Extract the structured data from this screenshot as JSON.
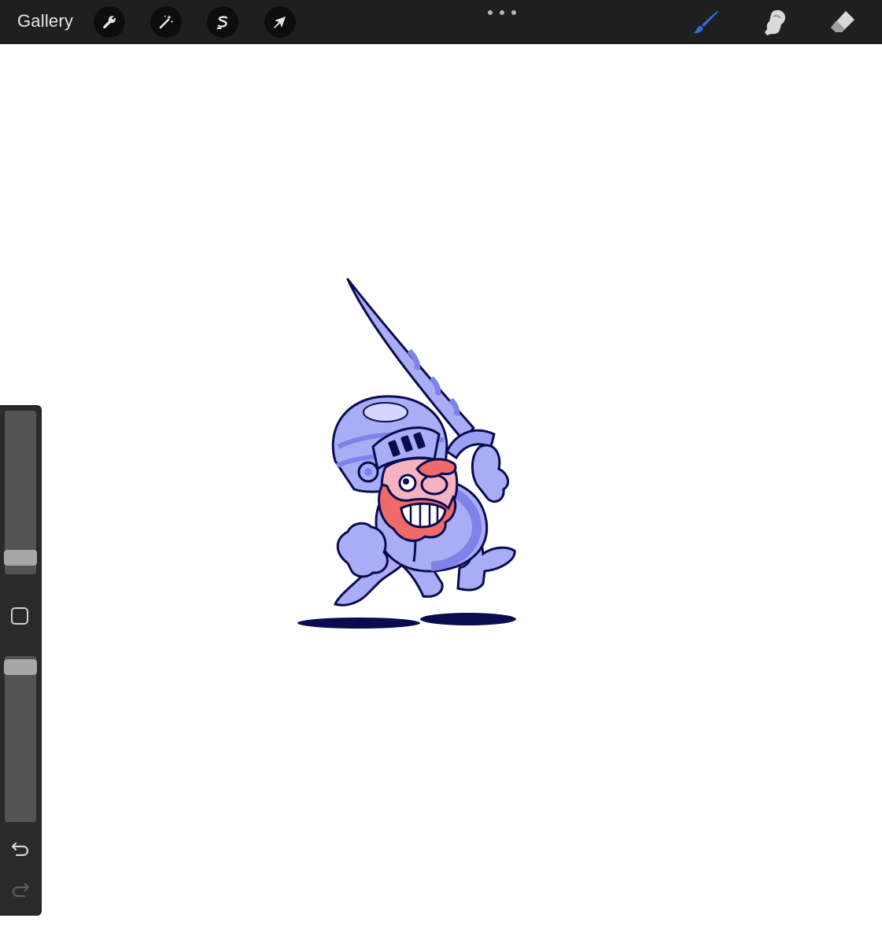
{
  "app": {
    "gallery_label": "Gallery"
  },
  "toolbar": {
    "left_tools": [
      {
        "name": "actions",
        "icon": "wrench-icon"
      },
      {
        "name": "adjustments",
        "icon": "magic-wand-icon"
      },
      {
        "name": "selection",
        "icon": "selection-s-icon"
      },
      {
        "name": "transform",
        "icon": "arrow-cursor-icon"
      }
    ],
    "more_icon": "ellipsis-icon",
    "right_tools": [
      {
        "name": "brush",
        "icon": "brush-icon",
        "active": true
      },
      {
        "name": "smudge",
        "icon": "smudge-finger-icon",
        "active": false
      },
      {
        "name": "eraser",
        "icon": "eraser-icon",
        "active": false
      }
    ],
    "active_color": "#2f6fdb"
  },
  "sidebar": {
    "brush_size_level": 0.06,
    "opacity_level": 0.98,
    "modify_icon": "square-modify-icon",
    "undo_icon": "undo-icon",
    "redo_icon": "redo-icon"
  },
  "colors": {
    "armor": "#a9adf5",
    "armor_dark": "#7f82e6",
    "outline": "#0b0b4f",
    "beard": "#f06a6a",
    "skin": "#f5b3c0",
    "shadow": "#0b0b4f"
  }
}
